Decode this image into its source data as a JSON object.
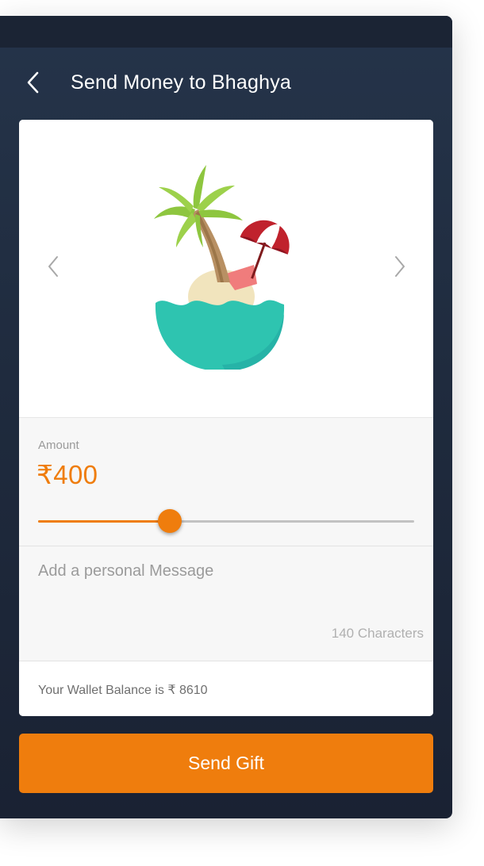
{
  "header": {
    "title": "Send Money to Bhaghya",
    "back_icon": "chevron-left-icon"
  },
  "gift_card": {
    "prev_icon": "chevron-left-icon",
    "next_icon": "chevron-right-icon",
    "illustration": "beach-island-icon"
  },
  "amount": {
    "label": "Amount",
    "value": "₹400",
    "slider_fraction": 0.35
  },
  "message": {
    "placeholder": "Add a personal Message",
    "char_limit_text": "140 Characters"
  },
  "wallet": {
    "balance_text": "Your Wallet Balance is ₹ 8610"
  },
  "actions": {
    "send_label": "Send Gift"
  },
  "colors": {
    "accent": "#ef7d0d",
    "header_bg": "#24324a",
    "card_bg": "#ffffff",
    "section_bg": "#f7f7f7"
  }
}
